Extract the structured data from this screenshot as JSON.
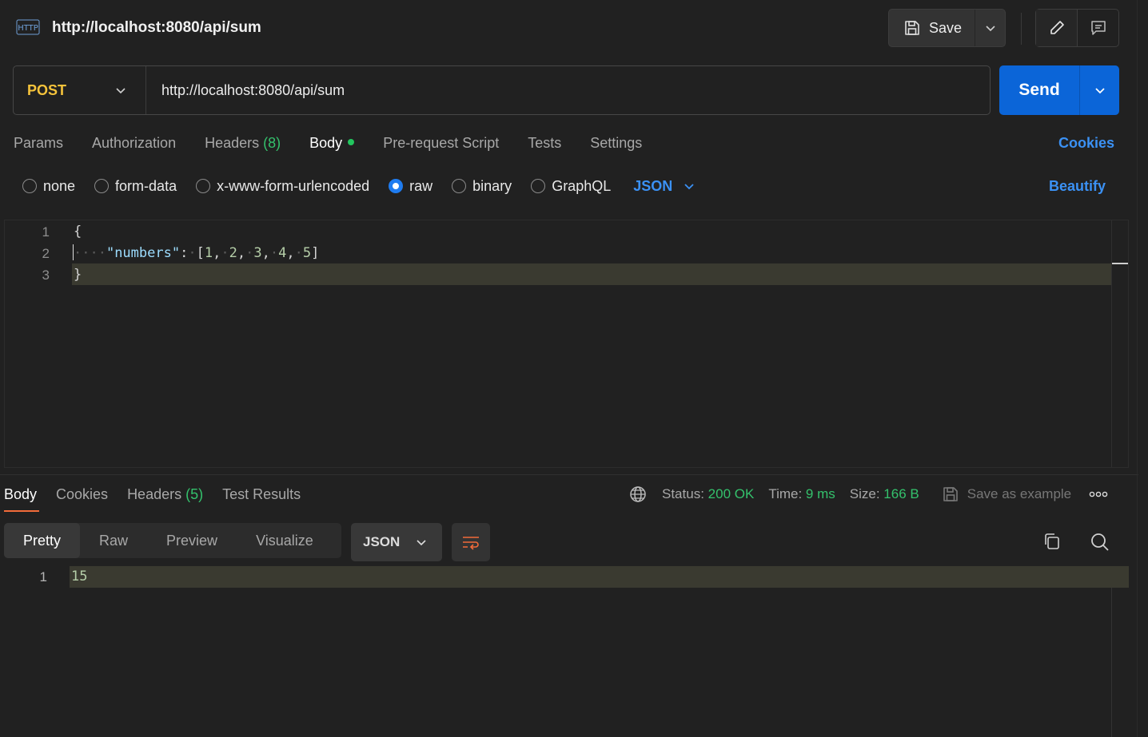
{
  "header": {
    "title": "http://localhost:8080/api/sum",
    "request_icon": "HTTP",
    "save_label": "Save"
  },
  "request": {
    "method": "POST",
    "url": "http://localhost:8080/api/sum",
    "send_label": "Send"
  },
  "req_tabs": {
    "params": "Params",
    "authorization": "Authorization",
    "headers": "Headers",
    "headers_count": "(8)",
    "body": "Body",
    "prerequest": "Pre-request Script",
    "tests": "Tests",
    "settings": "Settings",
    "cookies": "Cookies"
  },
  "body_options": {
    "none": "none",
    "form_data": "form-data",
    "urlencoded": "x-www-form-urlencoded",
    "raw": "raw",
    "binary": "binary",
    "graphql": "GraphQL",
    "selected": "raw",
    "format": "JSON",
    "beautify": "Beautify"
  },
  "editor": {
    "line_numbers": [
      "1",
      "2",
      "3"
    ],
    "line1": "{",
    "line2_ws": "····",
    "line2_key": "\"numbers\"",
    "line2_colon": ":",
    "line2_sp": "·",
    "line2_array": [
      "1",
      "2",
      "3",
      "4",
      "5"
    ],
    "line3": "}"
  },
  "response": {
    "tabs": {
      "body": "Body",
      "cookies": "Cookies",
      "headers": "Headers",
      "headers_count": "(5)",
      "test_results": "Test Results"
    },
    "status_label": "Status:",
    "status_value": "200 OK",
    "time_label": "Time:",
    "time_value": "9 ms",
    "size_label": "Size:",
    "size_value": "166 B",
    "save_example": "Save as example",
    "views": {
      "pretty": "Pretty",
      "raw": "Raw",
      "preview": "Preview",
      "visualize": "Visualize"
    },
    "format": "JSON",
    "line_number": "1",
    "body_value": "15"
  },
  "colors": {
    "accent_blue": "#0b65d8",
    "link_blue": "#3b91f4",
    "method_yellow": "#f5c33b",
    "success_green": "#34c16c",
    "tab_underline": "#f26b3a"
  }
}
